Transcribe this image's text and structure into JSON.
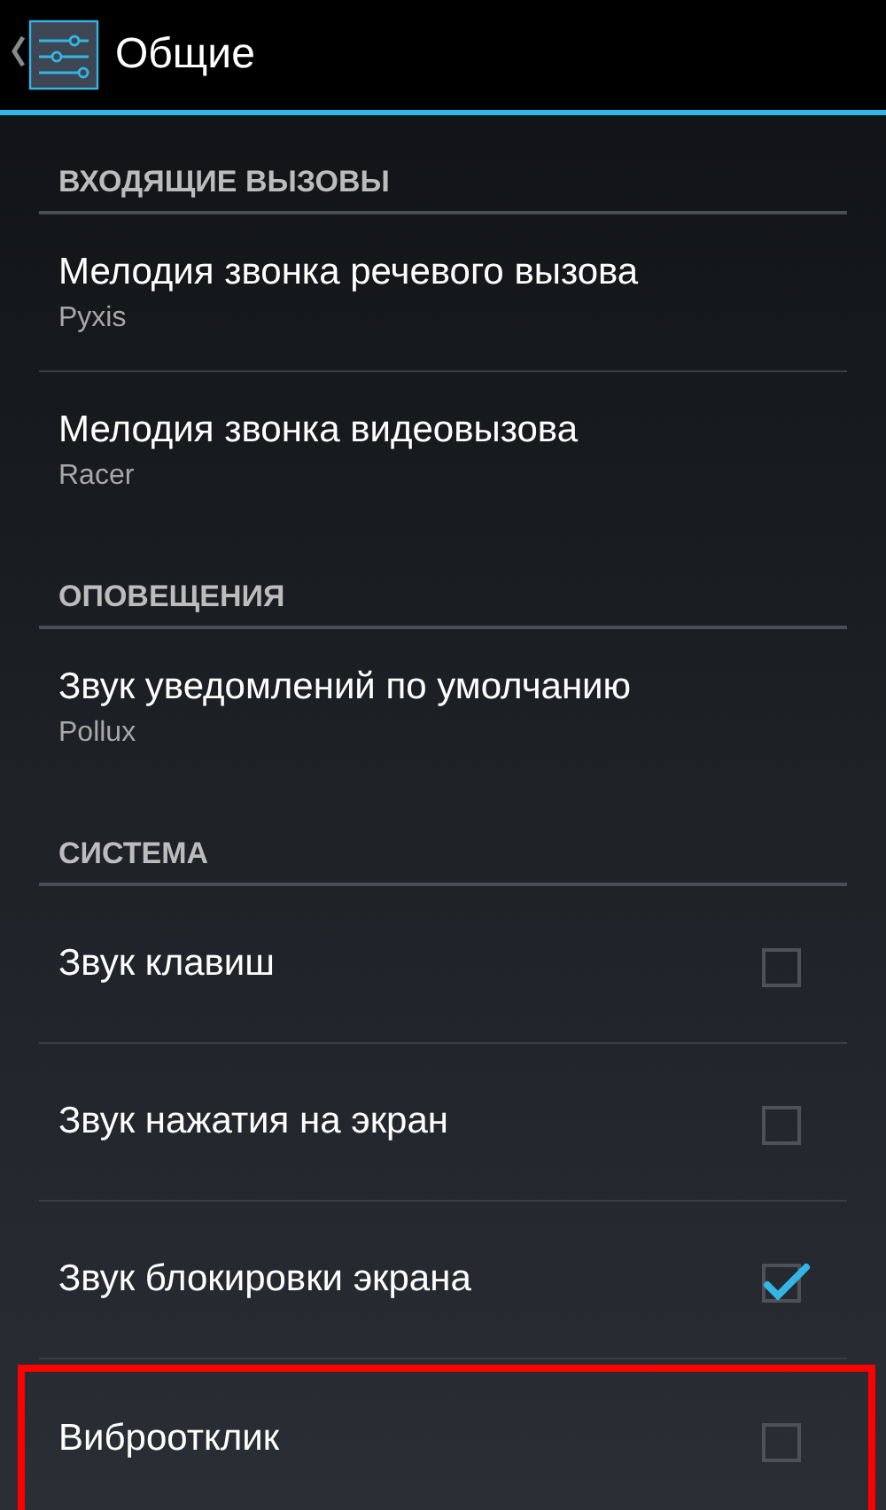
{
  "action_bar": {
    "title": "Общие"
  },
  "sections": [
    {
      "title": "ВХОДЯЩИЕ ВЫЗОВЫ",
      "items": [
        {
          "kind": "ringtone",
          "title": "Мелодия звонка речевого вызова",
          "summary": "Pyxis"
        },
        {
          "kind": "ringtone",
          "title": "Мелодия звонка видеовызова",
          "summary": "Racer"
        }
      ]
    },
    {
      "title": "ОПОВЕЩЕНИЯ",
      "items": [
        {
          "kind": "ringtone",
          "title": "Звук уведомлений по умолчанию",
          "summary": "Pollux"
        }
      ]
    },
    {
      "title": "СИСТЕМА",
      "items": [
        {
          "kind": "checkbox",
          "title": "Звук клавиш",
          "checked": false,
          "highlighted": false
        },
        {
          "kind": "checkbox",
          "title": "Звук нажатия на экран",
          "checked": false,
          "highlighted": false
        },
        {
          "kind": "checkbox",
          "title": "Звук блокировки экрана",
          "checked": true,
          "highlighted": false
        },
        {
          "kind": "checkbox",
          "title": "Виброотклик",
          "checked": false,
          "highlighted": true
        }
      ]
    }
  ]
}
